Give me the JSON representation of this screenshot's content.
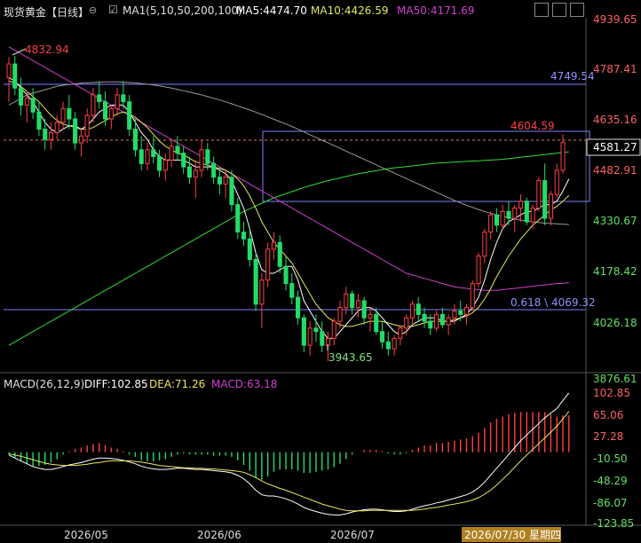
{
  "header": {
    "instrument": "现货黄金",
    "period": "【日线】",
    "ma_title": "MA1(5,10,50,200,100)",
    "ma5": "MA5:4474.70",
    "ma10": "MA10:4426.59",
    "ma50": "MA50:4171.69"
  },
  "macd_header": {
    "title": "MACD(26,12,9)",
    "diff": "DIFF:102.85",
    "dea": "DEA:71.26",
    "macd": "MACD:63.18"
  },
  "price_axis": [
    "4939.65",
    "4787.41",
    "4635.16",
    "4482.91",
    "4330.67",
    "4178.42",
    "4026.18",
    "3876.61"
  ],
  "macd_axis": [
    "102.85",
    "65.06",
    "27.28",
    "-10.50",
    "-48.29",
    "-86.07",
    "-123.85"
  ],
  "current_price": "4581.27",
  "annotations": {
    "high": "4832.94",
    "low": "3943.65",
    "line_4749": "4749.54",
    "line_4604": "4604.59",
    "fib": "0.618 \\ 4069.32"
  },
  "time_axis": [
    "2026/05",
    "2026/06",
    "2026/07",
    "2026/07/30 星期四"
  ],
  "colors": {
    "up": "#ff4040",
    "down": "#22dd66",
    "ma5": "#ffffff",
    "ma10": "#e8e85a",
    "ma50": "#d040d0",
    "ma100": "#999999",
    "ma200": "#33dd33",
    "hline": "#8080ff"
  },
  "chart_data": {
    "type": "candlestick",
    "candles": [
      [
        4770,
        4830,
        4700,
        4810
      ],
      [
        4810,
        4833,
        4720,
        4740
      ],
      [
        4740,
        4770,
        4660,
        4690
      ],
      [
        4690,
        4730,
        4640,
        4710
      ],
      [
        4710,
        4740,
        4650,
        4670
      ],
      [
        4670,
        4700,
        4600,
        4620
      ],
      [
        4620,
        4650,
        4560,
        4590
      ],
      [
        4590,
        4640,
        4560,
        4610
      ],
      [
        4610,
        4660,
        4590,
        4640
      ],
      [
        4640,
        4700,
        4620,
        4680
      ],
      [
        4680,
        4720,
        4620,
        4650
      ],
      [
        4650,
        4670,
        4560,
        4580
      ],
      [
        4580,
        4620,
        4540,
        4600
      ],
      [
        4600,
        4680,
        4580,
        4660
      ],
      [
        4660,
        4740,
        4640,
        4720
      ],
      [
        4720,
        4760,
        4680,
        4700
      ],
      [
        4700,
        4730,
        4630,
        4650
      ],
      [
        4650,
        4690,
        4620,
        4680
      ],
      [
        4680,
        4740,
        4660,
        4720
      ],
      [
        4720,
        4760,
        4680,
        4700
      ],
      [
        4700,
        4720,
        4600,
        4620
      ],
      [
        4620,
        4650,
        4540,
        4560
      ],
      [
        4560,
        4600,
        4500,
        4520
      ],
      [
        4520,
        4580,
        4500,
        4560
      ],
      [
        4560,
        4600,
        4520,
        4540
      ],
      [
        4540,
        4560,
        4480,
        4500
      ],
      [
        4500,
        4550,
        4470,
        4530
      ],
      [
        4530,
        4590,
        4510,
        4570
      ],
      [
        4570,
        4600,
        4530,
        4550
      ],
      [
        4550,
        4570,
        4490,
        4510
      ],
      [
        4510,
        4540,
        4460,
        4480
      ],
      [
        4480,
        4530,
        4420,
        4500
      ],
      [
        4500,
        4590,
        4480,
        4560
      ],
      [
        4560,
        4580,
        4500,
        4520
      ],
      [
        4520,
        4540,
        4460,
        4480
      ],
      [
        4480,
        4510,
        4430,
        4460
      ],
      [
        4460,
        4500,
        4420,
        4480
      ],
      [
        4480,
        4500,
        4380,
        4400
      ],
      [
        4400,
        4420,
        4300,
        4320
      ],
      [
        4320,
        4350,
        4280,
        4300
      ],
      [
        4300,
        4330,
        4220,
        4240
      ],
      [
        4240,
        4260,
        4090,
        4110
      ],
      [
        4110,
        4200,
        4040,
        4180
      ],
      [
        4180,
        4290,
        4160,
        4270
      ],
      [
        4270,
        4320,
        4240,
        4290
      ],
      [
        4290,
        4310,
        4200,
        4220
      ],
      [
        4220,
        4250,
        4150,
        4170
      ],
      [
        4170,
        4200,
        4110,
        4130
      ],
      [
        4130,
        4150,
        4050,
        4070
      ],
      [
        4070,
        4080,
        3970,
        3990
      ],
      [
        3990,
        4060,
        3960,
        4040
      ],
      [
        4040,
        4080,
        4000,
        4030
      ],
      [
        4030,
        4060,
        3970,
        3990
      ],
      [
        3990,
        4030,
        3944,
        4010
      ],
      [
        4010,
        4070,
        3990,
        4060
      ],
      [
        4060,
        4120,
        4040,
        4100
      ],
      [
        4100,
        4160,
        4080,
        4140
      ],
      [
        4140,
        4150,
        4080,
        4100
      ],
      [
        4100,
        4140,
        4070,
        4120
      ],
      [
        4120,
        4130,
        4050,
        4070
      ],
      [
        4070,
        4100,
        4030,
        4080
      ],
      [
        4080,
        4100,
        4020,
        4030
      ],
      [
        4030,
        4060,
        3980,
        4000
      ],
      [
        4000,
        4030,
        3960,
        3980
      ],
      [
        3980,
        4020,
        3960,
        4010
      ],
      [
        4010,
        4050,
        3990,
        4040
      ],
      [
        4040,
        4080,
        4020,
        4070
      ],
      [
        4070,
        4120,
        4050,
        4110
      ],
      [
        4110,
        4130,
        4060,
        4080
      ],
      [
        4080,
        4100,
        4040,
        4060
      ],
      [
        4060,
        4080,
        4020,
        4040
      ],
      [
        4040,
        4090,
        4030,
        4080
      ],
      [
        4080,
        4100,
        4040,
        4050
      ],
      [
        4050,
        4080,
        4020,
        4070
      ],
      [
        4070,
        4110,
        4050,
        4090
      ],
      [
        4090,
        4120,
        4060,
        4080
      ],
      [
        4080,
        4110,
        4050,
        4100
      ],
      [
        4100,
        4180,
        4090,
        4170
      ],
      [
        4170,
        4260,
        4160,
        4250
      ],
      [
        4250,
        4330,
        4230,
        4320
      ],
      [
        4320,
        4380,
        4300,
        4370
      ],
      [
        4370,
        4390,
        4320,
        4340
      ],
      [
        4340,
        4400,
        4330,
        4380
      ],
      [
        4380,
        4410,
        4340,
        4360
      ],
      [
        4360,
        4400,
        4320,
        4390
      ],
      [
        4390,
        4430,
        4350,
        4410
      ],
      [
        4410,
        4420,
        4340,
        4350
      ],
      [
        4350,
        4400,
        4330,
        4390
      ],
      [
        4390,
        4480,
        4380,
        4470
      ],
      [
        4470,
        4520,
        4340,
        4360
      ],
      [
        4360,
        4440,
        4340,
        4430
      ],
      [
        4430,
        4520,
        4420,
        4500
      ],
      [
        4500,
        4605,
        4490,
        4581
      ]
    ],
    "ma5": [
      4770,
      4760,
      4740,
      4720,
      4700,
      4670,
      4640,
      4620,
      4610,
      4620,
      4630,
      4630,
      4620,
      4630,
      4650,
      4670,
      4680,
      4690,
      4690,
      4690,
      4670,
      4640,
      4610,
      4590,
      4560,
      4540,
      4530,
      4530,
      4530,
      4530,
      4520,
      4510,
      4510,
      4510,
      4510,
      4500,
      4490,
      4470,
      4430,
      4390,
      4330,
      4260,
      4210,
      4200,
      4200,
      4210,
      4220,
      4220,
      4180,
      4120,
      4090,
      4060,
      4030,
      4010,
      4010,
      4030,
      4050,
      4070,
      4090,
      4100,
      4100,
      4090,
      4070,
      4050,
      4030,
      4020,
      4030,
      4050,
      4060,
      4070,
      4070,
      4070,
      4060,
      4060,
      4060,
      4070,
      4080,
      4100,
      4130,
      4180,
      4240,
      4290,
      4330,
      4350,
      4360,
      4370,
      4380,
      4380,
      4390,
      4400,
      4400,
      4410,
      4440,
      4475
    ],
    "ma10": [
      4760,
      4755,
      4745,
      4730,
      4715,
      4700,
      4680,
      4660,
      4645,
      4635,
      4630,
      4625,
      4620,
      4620,
      4625,
      4635,
      4645,
      4655,
      4665,
      4670,
      4665,
      4655,
      4640,
      4625,
      4605,
      4585,
      4570,
      4560,
      4550,
      4545,
      4535,
      4525,
      4520,
      4515,
      4510,
      4505,
      4500,
      4490,
      4475,
      4455,
      4425,
      4390,
      4350,
      4320,
      4290,
      4270,
      4250,
      4230,
      4200,
      4170,
      4140,
      4110,
      4090,
      4070,
      4060,
      4050,
      4045,
      4045,
      4050,
      4055,
      4060,
      4060,
      4060,
      4055,
      4050,
      4045,
      4045,
      4045,
      4050,
      4055,
      4060,
      4060,
      4060,
      4060,
      4065,
      4070,
      4075,
      4085,
      4100,
      4125,
      4155,
      4190,
      4220,
      4250,
      4275,
      4300,
      4320,
      4340,
      4355,
      4370,
      4385,
      4395,
      4410,
      4427
    ],
    "ma50": [
      4860,
      4850,
      4840,
      4830,
      4820,
      4810,
      4800,
      4790,
      4780,
      4770,
      4760,
      4750,
      4740,
      4730,
      4720,
      4710,
      4700,
      4690,
      4680,
      4670,
      4660,
      4650,
      4640,
      4630,
      4620,
      4610,
      4600,
      4590,
      4580,
      4570,
      4560,
      4550,
      4540,
      4530,
      4520,
      4510,
      4500,
      4490,
      4480,
      4470,
      4460,
      4450,
      4440,
      4430,
      4420,
      4410,
      4400,
      4390,
      4380,
      4370,
      4360,
      4350,
      4340,
      4330,
      4320,
      4310,
      4300,
      4290,
      4280,
      4270,
      4260,
      4250,
      4240,
      4230,
      4220,
      4210,
      4200,
      4195,
      4190,
      4185,
      4180,
      4175,
      4170,
      4165,
      4160,
      4158,
      4156,
      4154,
      4152,
      4150,
      4150,
      4150,
      4152,
      4154,
      4156,
      4158,
      4160,
      4162,
      4164,
      4166,
      4168,
      4170,
      4171,
      4172
    ],
    "ma100": [
      4690,
      4700,
      4710,
      4720,
      4725,
      4730,
      4735,
      4740,
      4745,
      4748,
      4750,
      4752,
      4754,
      4755,
      4756,
      4757,
      4758,
      4758,
      4758,
      4757,
      4756,
      4755,
      4753,
      4751,
      4749,
      4746,
      4743,
      4740,
      4736,
      4732,
      4728,
      4724,
      4720,
      4715,
      4710,
      4705,
      4700,
      4694,
      4688,
      4682,
      4676,
      4670,
      4663,
      4656,
      4649,
      4642,
      4635,
      4628,
      4620,
      4612,
      4604,
      4596,
      4588,
      4580,
      4572,
      4564,
      4556,
      4548,
      4540,
      4532,
      4524,
      4516,
      4508,
      4500,
      4492,
      4484,
      4476,
      4468,
      4460,
      4452,
      4444,
      4436,
      4428,
      4420,
      4412,
      4405,
      4398,
      4392,
      4386,
      4380,
      4375,
      4370,
      4366,
      4362,
      4358,
      4355,
      4352,
      4350,
      4348,
      4346,
      4345,
      4344,
      4343,
      4342
    ],
    "ma200": [
      3990,
      4000,
      4010,
      4020,
      4030,
      4040,
      4050,
      4060,
      4070,
      4080,
      4090,
      4100,
      4110,
      4120,
      4130,
      4140,
      4150,
      4160,
      4170,
      4180,
      4190,
      4200,
      4210,
      4220,
      4230,
      4240,
      4250,
      4260,
      4270,
      4280,
      4290,
      4300,
      4310,
      4320,
      4330,
      4340,
      4350,
      4360,
      4370,
      4380,
      4388,
      4396,
      4404,
      4412,
      4420,
      4426,
      4432,
      4438,
      4444,
      4450,
      4455,
      4460,
      4465,
      4470,
      4474,
      4478,
      4482,
      4486,
      4490,
      4493,
      4496,
      4499,
      4502,
      4505,
      4507,
      4509,
      4511,
      4513,
      4515,
      4517,
      4519,
      4521,
      4522,
      4523,
      4524,
      4525,
      4526,
      4527,
      4528,
      4529,
      4530,
      4531,
      4532,
      4534,
      4536,
      4538,
      4540,
      4542,
      4544,
      4546,
      4548,
      4550,
      4552,
      4554
    ],
    "macd_diff": [
      -5,
      -10,
      -15,
      -20,
      -25,
      -28,
      -30,
      -30,
      -28,
      -25,
      -22,
      -20,
      -18,
      -15,
      -12,
      -10,
      -10,
      -11,
      -12,
      -14,
      -17,
      -20,
      -24,
      -27,
      -29,
      -30,
      -30,
      -29,
      -28,
      -28,
      -29,
      -30,
      -30,
      -31,
      -32,
      -33,
      -34,
      -36,
      -40,
      -46,
      -55,
      -66,
      -74,
      -76,
      -76,
      -78,
      -81,
      -85,
      -90,
      -96,
      -100,
      -103,
      -106,
      -108,
      -109,
      -109,
      -107,
      -104,
      -102,
      -100,
      -99,
      -99,
      -100,
      -102,
      -103,
      -103,
      -102,
      -99,
      -96,
      -93,
      -91,
      -88,
      -86,
      -83,
      -80,
      -77,
      -74,
      -69,
      -62,
      -52,
      -40,
      -28,
      -16,
      -4,
      8,
      20,
      30,
      40,
      50,
      60,
      68,
      76,
      90,
      103
    ],
    "macd_dea": [
      -3,
      -5,
      -7,
      -10,
      -13,
      -16,
      -19,
      -21,
      -22,
      -23,
      -23,
      -23,
      -22,
      -21,
      -19,
      -18,
      -16,
      -15,
      -15,
      -15,
      -15,
      -16,
      -17,
      -19,
      -21,
      -23,
      -24,
      -25,
      -26,
      -27,
      -27,
      -28,
      -28,
      -29,
      -29,
      -30,
      -31,
      -32,
      -33,
      -35,
      -39,
      -44,
      -50,
      -55,
      -59,
      -63,
      -66,
      -70,
      -74,
      -78,
      -82,
      -86,
      -90,
      -93,
      -96,
      -99,
      -101,
      -102,
      -102,
      -102,
      -101,
      -101,
      -101,
      -101,
      -101,
      -101,
      -101,
      -101,
      -100,
      -99,
      -97,
      -96,
      -94,
      -92,
      -90,
      -88,
      -86,
      -83,
      -79,
      -73,
      -66,
      -57,
      -47,
      -37,
      -26,
      -15,
      -5,
      5,
      15,
      25,
      35,
      45,
      58,
      71
    ],
    "ylim_price": [
      3876.61,
      4939.65
    ],
    "ylim_macd": [
      -123.85,
      102.85
    ]
  }
}
